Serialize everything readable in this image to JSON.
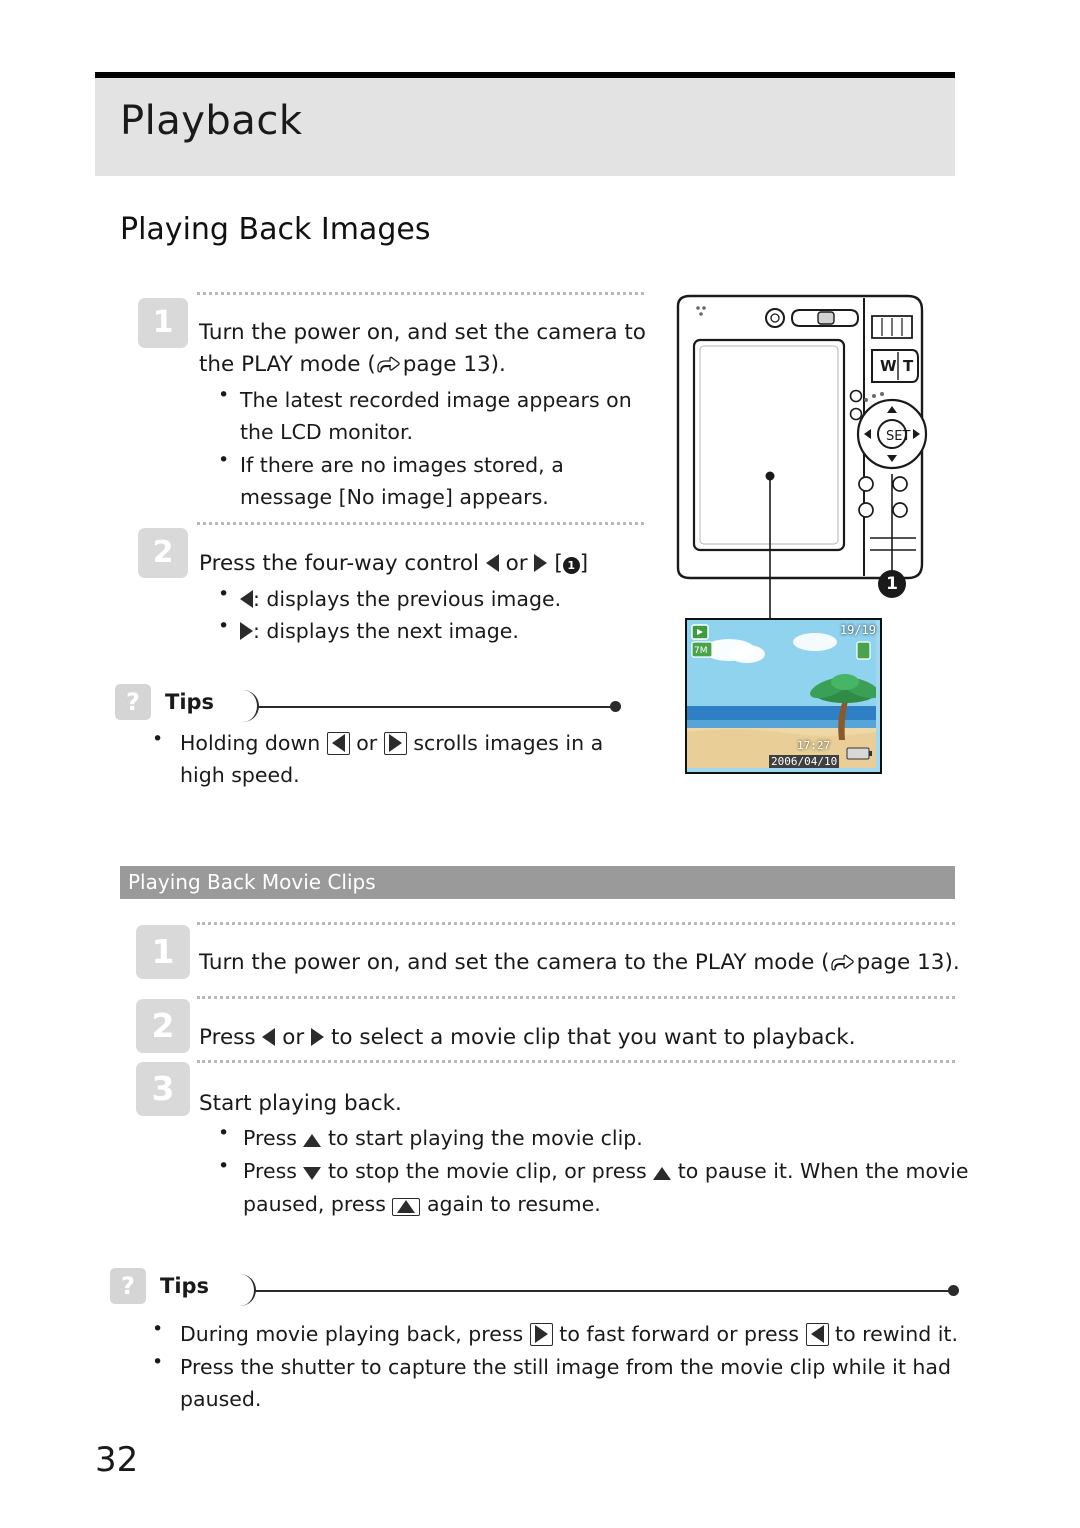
{
  "header": {
    "title": "Playback"
  },
  "section": {
    "title": "Playing Back Images"
  },
  "steps_images": [
    {
      "num": "1",
      "line1": "Turn the power on, and set the camera to",
      "line2_pre": "the PLAY mode (",
      "line2_page": "page",
      "line2_num": "13",
      "line2_post": ").",
      "bullets": [
        {
          "l1": "The latest recorded image appears on",
          "l2": "the LCD monitor."
        },
        {
          "l1": "If there are no images stored, a",
          "l2_pre": "message [",
          "l2_key": "No image",
          "l2_post": "] appears."
        }
      ]
    },
    {
      "num": "2",
      "line1_pre": "Press the four-way control",
      "line1_or": "or",
      "line1_badge": "1",
      "bullets": [
        {
          "text": ": displays the previous image.",
          "arrow": "left"
        },
        {
          "text": ": displays the next image.",
          "arrow": "right"
        }
      ]
    }
  ],
  "tips_1": {
    "label": "Tips",
    "q": "?",
    "bullet_pre": "Holding down",
    "bullet_or": "or",
    "bullet_post": "scrolls images in a",
    "bullet_line2": "high speed."
  },
  "subsection": {
    "title": "Playing Back Movie Clips"
  },
  "steps_movie": [
    {
      "num": "1",
      "text_pre": "Turn the power on, and set the camera to the PLAY mode (",
      "text_page": "page",
      "text_num": "13",
      "text_post": ")."
    },
    {
      "num": "2",
      "text_pre": "Press",
      "text_or": "or",
      "text_post": "to select a movie clip that you want to playback."
    },
    {
      "num": "3",
      "text": "Start playing back.",
      "bullets": [
        {
          "pre": "Press",
          "post": "to start playing the movie clip."
        },
        {
          "pre": "Press",
          "mid": "to stop the movie clip, or press",
          "post": "to pause it. When the movie",
          "line2_pre": "paused, press",
          "line2_post": "again to resume."
        }
      ]
    }
  ],
  "tips_2": {
    "label": "Tips",
    "q": "?",
    "bullets": [
      {
        "pre": "During movie playing back, press",
        "mid": "to fast forward or press",
        "post": "to rewind it."
      },
      {
        "l1": "Press the shutter to capture the still image from the movie clip while it had",
        "l2": "paused."
      }
    ]
  },
  "lcd": {
    "counter": "19/19",
    "resolution": "7M",
    "time": "17:27",
    "date": "2006/04/10"
  },
  "camera": {
    "zoom_wide": "W",
    "zoom_tele": "T",
    "callout_1": "1"
  },
  "page_number": "32"
}
